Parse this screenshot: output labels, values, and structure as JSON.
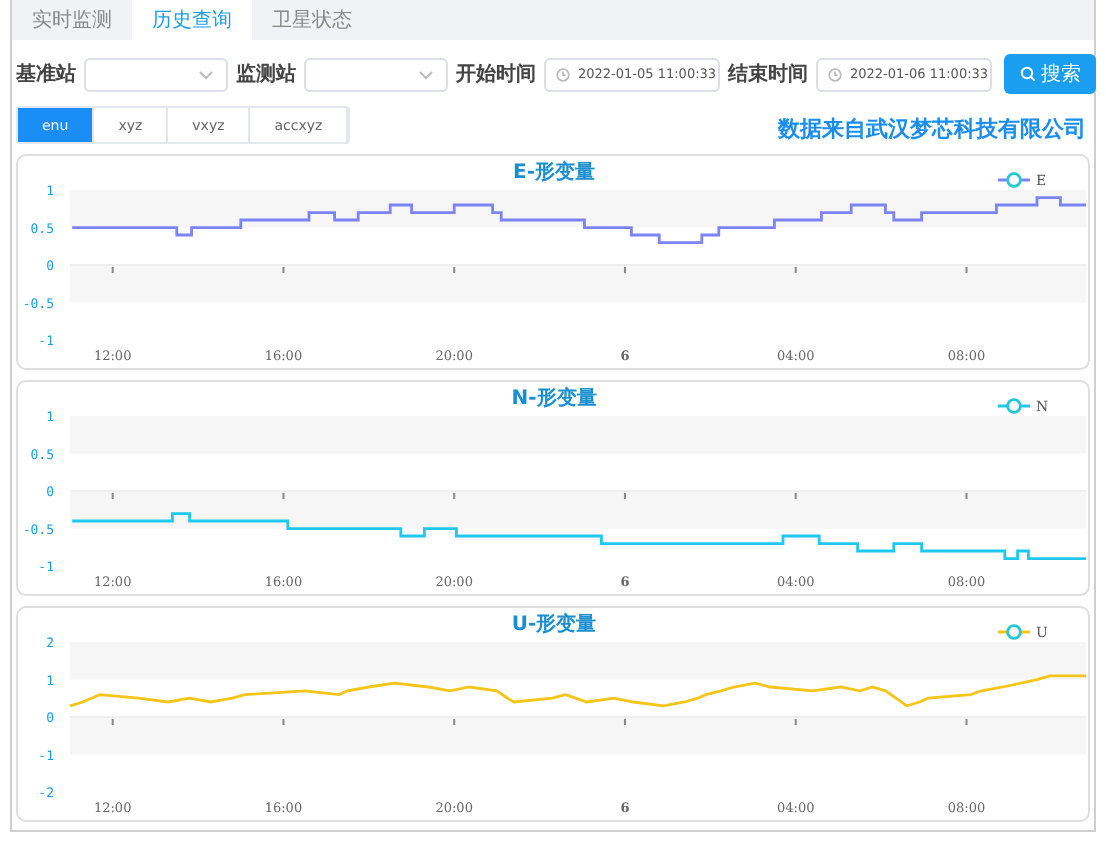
{
  "tabs": [
    {
      "label": "实时监测",
      "selected": false
    },
    {
      "label": "历史查询",
      "selected": true
    },
    {
      "label": "卫星状态",
      "selected": false
    }
  ],
  "filters": {
    "base_station_label": "基准站",
    "monitor_station_label": "监测站",
    "start_label": "开始时间",
    "start_value": "2022-01-05 11:00:33",
    "end_label": "结束时间",
    "end_value": "2022-01-06 11:00:33",
    "search_button": "搜索"
  },
  "modes": [
    {
      "label": "enu",
      "selected": true
    },
    {
      "label": "xyz",
      "selected": false
    },
    {
      "label": "vxyz",
      "selected": false
    },
    {
      "label": "accxyz",
      "selected": false
    }
  ],
  "source_note": "数据来自武汉梦芯科技有限公司",
  "charts": [
    {
      "chart_data": {
        "type": "line",
        "title": "E-形变量",
        "xlim": [
          "2022-01-05 11:00",
          "2022-01-06 10:48"
        ],
        "ylim": [
          -1,
          1
        ],
        "yticks": [
          {
            "value": 1,
            "label": "1"
          },
          {
            "value": 0.5,
            "label": "0.5"
          },
          {
            "value": 0,
            "label": "0"
          },
          {
            "value": -0.5,
            "label": "-0.5"
          },
          {
            "value": -1,
            "label": "-1"
          }
        ],
        "xticks": [
          {
            "value": "2022-01-05 12:00",
            "label": "12:00"
          },
          {
            "value": "2022-01-05 16:00",
            "label": "16:00"
          },
          {
            "value": "2022-01-05 20:00",
            "label": "20:00"
          },
          {
            "value": "2022-01-06 00:00",
            "label": "6"
          },
          {
            "value": "2022-01-06 04:00",
            "label": "04:00"
          },
          {
            "value": "2022-01-06 08:00",
            "label": "08:00"
          }
        ],
        "x": [
          "2022-01-05 11:03",
          "2022-01-05 13:30",
          "2022-01-05 13:30",
          "2022-01-05 13:51",
          "2022-01-05 13:51",
          "2022-01-05 15:00",
          "2022-01-05 15:00",
          "2022-01-05 16:36",
          "2022-01-05 16:36",
          "2022-01-05 17:12",
          "2022-01-05 17:12",
          "2022-01-05 17:45",
          "2022-01-05 17:45",
          "2022-01-05 18:30",
          "2022-01-05 18:30",
          "2022-01-05 19:00",
          "2022-01-05 19:00",
          "2022-01-05 20:00",
          "2022-01-05 20:00",
          "2022-01-05 20:54",
          "2022-01-05 20:54",
          "2022-01-05 21:06",
          "2022-01-05 21:06",
          "2022-01-05 23:03",
          "2022-01-05 23:03",
          "2022-01-06 00:09",
          "2022-01-06 00:09",
          "2022-01-06 00:48",
          "2022-01-06 00:48",
          "2022-01-06 01:48",
          "2022-01-06 01:48",
          "2022-01-06 02:12",
          "2022-01-06 02:12",
          "2022-01-06 03:30",
          "2022-01-06 03:30",
          "2022-01-06 04:36",
          "2022-01-06 04:36",
          "2022-01-06 05:18",
          "2022-01-06 05:18",
          "2022-01-06 06:06",
          "2022-01-06 06:06",
          "2022-01-06 06:18",
          "2022-01-06 06:18",
          "2022-01-06 06:57",
          "2022-01-06 06:57",
          "2022-01-06 08:42",
          "2022-01-06 08:42",
          "2022-01-06 09:39",
          "2022-01-06 09:39",
          "2022-01-06 10:12",
          "2022-01-06 10:12",
          "2022-01-06 10:48"
        ],
        "series": [
          {
            "name": "E",
            "color": "#7b83f5",
            "values": [
              0.5,
              0.5,
              0.4,
              0.4,
              0.5,
              0.5,
              0.6,
              0.6,
              0.7,
              0.7,
              0.6,
              0.6,
              0.7,
              0.7,
              0.8,
              0.8,
              0.7,
              0.7,
              0.8,
              0.8,
              0.7,
              0.7,
              0.6,
              0.6,
              0.5,
              0.5,
              0.4,
              0.4,
              0.3,
              0.3,
              0.4,
              0.4,
              0.5,
              0.5,
              0.6,
              0.6,
              0.7,
              0.7,
              0.8,
              0.8,
              0.7,
              0.7,
              0.6,
              0.6,
              0.7,
              0.7,
              0.8,
              0.8,
              0.9,
              0.9,
              0.8,
              0.8
            ]
          }
        ]
      }
    },
    {
      "chart_data": {
        "type": "line",
        "title": "N-形变量",
        "xlim": [
          "2022-01-05 11:00",
          "2022-01-06 10:48"
        ],
        "ylim": [
          -1,
          1
        ],
        "yticks": [
          {
            "value": 1,
            "label": "1"
          },
          {
            "value": 0.5,
            "label": "0.5"
          },
          {
            "value": 0,
            "label": "0"
          },
          {
            "value": -0.5,
            "label": "-0.5"
          },
          {
            "value": -1,
            "label": "-1"
          }
        ],
        "xticks": [
          {
            "value": "2022-01-05 12:00",
            "label": "12:00"
          },
          {
            "value": "2022-01-05 16:00",
            "label": "16:00"
          },
          {
            "value": "2022-01-05 20:00",
            "label": "20:00"
          },
          {
            "value": "2022-01-06 00:00",
            "label": "6"
          },
          {
            "value": "2022-01-06 04:00",
            "label": "04:00"
          },
          {
            "value": "2022-01-06 08:00",
            "label": "08:00"
          }
        ],
        "x": [
          "2022-01-05 11:03",
          "2022-01-05 13:24",
          "2022-01-05 13:24",
          "2022-01-05 13:48",
          "2022-01-05 13:48",
          "2022-01-05 16:06",
          "2022-01-05 16:06",
          "2022-01-05 18:45",
          "2022-01-05 18:45",
          "2022-01-05 19:18",
          "2022-01-05 19:18",
          "2022-01-05 20:03",
          "2022-01-05 20:03",
          "2022-01-05 23:27",
          "2022-01-05 23:27",
          "2022-01-06 03:42",
          "2022-01-06 03:42",
          "2022-01-06 04:33",
          "2022-01-06 04:33",
          "2022-01-06 05:27",
          "2022-01-06 05:27",
          "2022-01-06 06:18",
          "2022-01-06 06:18",
          "2022-01-06 06:57",
          "2022-01-06 06:57",
          "2022-01-06 08:54",
          "2022-01-06 08:54",
          "2022-01-06 09:12",
          "2022-01-06 09:12",
          "2022-01-06 09:27",
          "2022-01-06 09:27",
          "2022-01-06 10:48"
        ],
        "series": [
          {
            "name": "N",
            "color": "#1ec8f0",
            "values": [
              -0.4,
              -0.4,
              -0.3,
              -0.3,
              -0.4,
              -0.4,
              -0.5,
              -0.5,
              -0.6,
              -0.6,
              -0.5,
              -0.5,
              -0.6,
              -0.6,
              -0.7,
              -0.7,
              -0.6,
              -0.6,
              -0.7,
              -0.7,
              -0.8,
              -0.8,
              -0.7,
              -0.7,
              -0.8,
              -0.8,
              -0.9,
              -0.9,
              -0.8,
              -0.8,
              -0.9,
              -0.9
            ]
          }
        ]
      }
    },
    {
      "chart_data": {
        "type": "line",
        "title": "U-形变量",
        "xlim": [
          "2022-01-05 11:00",
          "2022-01-06 10:48"
        ],
        "ylim": [
          -2,
          2
        ],
        "yticks": [
          {
            "value": 2,
            "label": "2"
          },
          {
            "value": 1,
            "label": "1"
          },
          {
            "value": 0,
            "label": "0"
          },
          {
            "value": -1,
            "label": "-1"
          },
          {
            "value": -2,
            "label": "-2"
          }
        ],
        "xticks": [
          {
            "value": "2022-01-05 12:00",
            "label": "12:00"
          },
          {
            "value": "2022-01-05 16:00",
            "label": "16:00"
          },
          {
            "value": "2022-01-05 20:00",
            "label": "20:00"
          },
          {
            "value": "2022-01-06 00:00",
            "label": "6"
          },
          {
            "value": "2022-01-06 04:00",
            "label": "04:00"
          },
          {
            "value": "2022-01-06 08:00",
            "label": "08:00"
          }
        ],
        "x": [
          "2022-01-05 11:00",
          "2022-01-05 11:18",
          "2022-01-05 11:30",
          "2022-01-05 11:42",
          "2022-01-05 12:36",
          "2022-01-05 13:18",
          "2022-01-05 13:48",
          "2022-01-05 14:18",
          "2022-01-05 14:48",
          "2022-01-05 15:06",
          "2022-01-05 16:30",
          "2022-01-05 17:18",
          "2022-01-05 17:30",
          "2022-01-05 18:00",
          "2022-01-05 18:36",
          "2022-01-05 19:24",
          "2022-01-05 19:54",
          "2022-01-05 20:21",
          "2022-01-05 21:00",
          "2022-01-05 21:15",
          "2022-01-05 21:24",
          "2022-01-05 22:18",
          "2022-01-05 22:36",
          "2022-01-05 22:51",
          "2022-01-05 23:06",
          "2022-01-05 23:45",
          "2022-01-06 00:12",
          "2022-01-06 00:54",
          "2022-01-06 01:24",
          "2022-01-06 01:42",
          "2022-01-06 01:54",
          "2022-01-06 02:15",
          "2022-01-06 02:33",
          "2022-01-06 03:03",
          "2022-01-06 03:24",
          "2022-01-06 04:24",
          "2022-01-06 05:03",
          "2022-01-06 05:30",
          "2022-01-06 05:48",
          "2022-01-06 06:06",
          "2022-01-06 06:21",
          "2022-01-06 06:36",
          "2022-01-06 06:54",
          "2022-01-06 07:06",
          "2022-01-06 08:06",
          "2022-01-06 08:21",
          "2022-01-06 08:51",
          "2022-01-06 09:39",
          "2022-01-06 09:57",
          "2022-01-06 10:48"
        ],
        "series": [
          {
            "name": "U",
            "color": "#f5c518",
            "values": [
              0.3,
              0.4,
              0.5,
              0.6,
              0.5,
              0.4,
              0.5,
              0.4,
              0.5,
              0.6,
              0.7,
              0.6,
              0.7,
              0.8,
              0.9,
              0.8,
              0.7,
              0.8,
              0.7,
              0.5,
              0.4,
              0.5,
              0.6,
              0.5,
              0.4,
              0.5,
              0.4,
              0.3,
              0.4,
              0.5,
              0.6,
              0.7,
              0.8,
              0.9,
              0.8,
              0.7,
              0.8,
              0.7,
              0.8,
              0.7,
              0.5,
              0.3,
              0.4,
              0.5,
              0.6,
              0.7,
              0.8,
              1.0,
              1.1,
              1.1
            ]
          }
        ]
      }
    }
  ]
}
